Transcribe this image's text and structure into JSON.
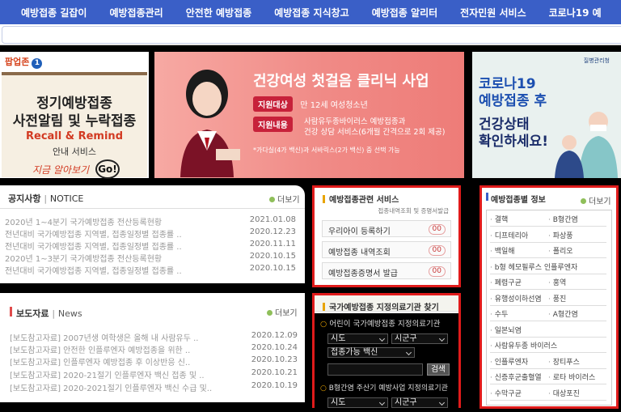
{
  "nav": [
    "예방접종 길잡이",
    "예방접종관리",
    "안전한 예방접종",
    "예방접종 지식창고",
    "예방접종 알리터",
    "전자민원 서비스",
    "코로나19 예"
  ],
  "popup": {
    "label": "팝업존",
    "number": "1",
    "line1": "정기예방접종",
    "line2": "사전알림 및 누락접종",
    "line3": "Recall & Remind",
    "line4": "안내 서비스",
    "line5": "지금 알아보기",
    "go": "Go!"
  },
  "banner": {
    "title": "건강여성 첫걸음 클리닉 사업",
    "target_tag": "지원대상",
    "target_text": "만 12세 여성청소년",
    "content_tag": "지원내용",
    "content_text1": "사람유두종바이러스 예방접종과",
    "content_text2": "건강 상담 서비스(6개월 간격으로 2회 제공)",
    "note": "*가다실(4가 백신)과 서바릭스(2가 백신) 중 선택 가능"
  },
  "covid": {
    "org": "질병관리청",
    "title1": "코로나19",
    "title2": "예방접종 후",
    "sub1": "건강상태",
    "sub2": "확인하세요!"
  },
  "notice": {
    "title_a": "공지사항",
    "title_b": "NOTICE",
    "more": "더보기",
    "rows": [
      {
        "text": "2020년 1~4분기 국가예방접종 전산등록현황",
        "date": "2021.01.08"
      },
      {
        "text": "전년대비 국가예방접종 지역별, 접종일정별 접종률 ..",
        "date": "2020.12.23"
      },
      {
        "text": "전년대비 국가예방접종 지역별, 접종일정별 접종률 ..",
        "date": "2020.11.11"
      },
      {
        "text": "2020년 1~3분기 국가예방접종 전산등록현황",
        "date": "2020.10.15"
      },
      {
        "text": "전년대비 국가예방접종 지역별, 접종일정별 접종률 ..",
        "date": "2020.10.15"
      }
    ]
  },
  "press": {
    "title_a": "보도자료",
    "title_b": "News",
    "more": "더보기",
    "rows": [
      {
        "text": "[보도참고자료] 2007년생 여학생은 올해 내 사람유두 ..",
        "date": "2020.12.09"
      },
      {
        "text": "[보도참고자료] 안전한 인플루엔자 예방접종을 위한 ..",
        "date": "2020.10.24"
      },
      {
        "text": "[보도참고자료] 인플루엔자 예방접종 후 이상반응 신..",
        "date": "2020.10.23"
      },
      {
        "text": "[보도참고자료] 2020-21절기 인플루엔자 백신 접종 및 ..",
        "date": "2020.10.21"
      },
      {
        "text": "[보도참고자료] 2020-2021절기 인플루엔자 백신 수급 및..",
        "date": "2020.10.19"
      }
    ]
  },
  "services": {
    "title": "예방접종관련 서비스",
    "subtitle": "접종내역조회 및 증명서발급",
    "buttons": [
      {
        "label": "우리아이 등록하기",
        "badge": "00"
      },
      {
        "label": "예방접종 내역조회",
        "badge": "00"
      },
      {
        "label": "예방접종증명서 발급",
        "badge": "00"
      }
    ]
  },
  "clinic": {
    "title": "국가예방접종 지정의료기관 찾기",
    "section1": "어린이 국가예방접종 지정의료기관",
    "sido": "시도",
    "sigungu": "시군구",
    "vaccine": "접종가능 백신",
    "search_btn": "검색",
    "section2": "B형간염 주산기 예방사업 지정의료기관",
    "sido2": "시도",
    "sigungu2": "시군구"
  },
  "vaccines": {
    "title": "예방접종별 정보",
    "more": "더보기",
    "rows": [
      [
        "결핵",
        "B형간염"
      ],
      [
        "디프테리아",
        "파상풍"
      ],
      [
        "백일해",
        "폴리오"
      ],
      [
        "b형 헤모필루스 인플루엔자",
        ""
      ],
      [
        "폐렴구균",
        "홍역"
      ],
      [
        "유행성이하선염",
        "풍진"
      ],
      [
        "수두",
        "A형간염"
      ],
      [
        "일본뇌염",
        ""
      ],
      [
        "사람유두종 바이러스",
        ""
      ],
      [
        "인플루엔자",
        "장티푸스"
      ],
      [
        "신증후군출혈열",
        "로타 바이러스"
      ],
      [
        "수막구균",
        "대상포진"
      ]
    ]
  }
}
